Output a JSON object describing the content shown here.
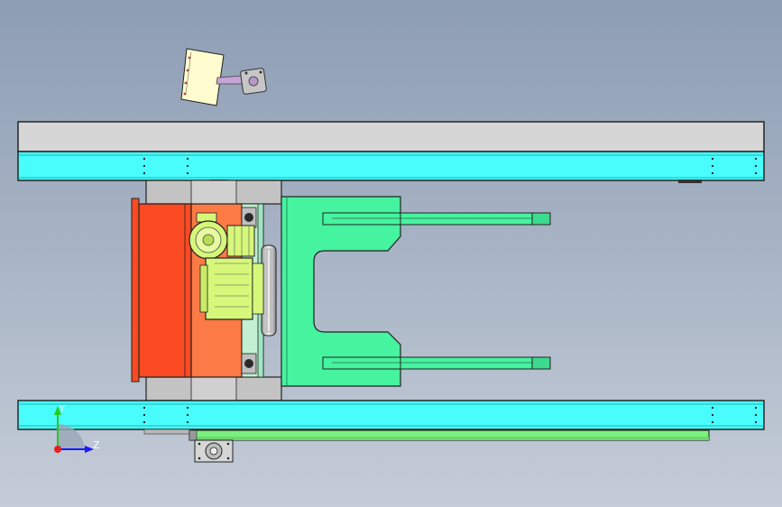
{
  "viewport": {
    "background_top": "#8d9db4",
    "background_bottom": "#c4ccd7"
  },
  "colors": {
    "rail_light": "#d6d6d6",
    "rail_cyan": "#49fdfd",
    "body_red": "#fc4a22",
    "body_orange": "#fc7a45",
    "fork_green": "#46f39f",
    "motor_yellow": "#d6f77a",
    "strip_green": "#7cf07e",
    "label_cream": "#fffdcf",
    "block_gray": "#c3c3c3",
    "outline": "#1a1a1a"
  },
  "triad": {
    "y_label": "Y",
    "z_label": "Z",
    "y_color": "#22cc22",
    "z_color": "#1a1aff",
    "origin_color": "#e02020"
  }
}
